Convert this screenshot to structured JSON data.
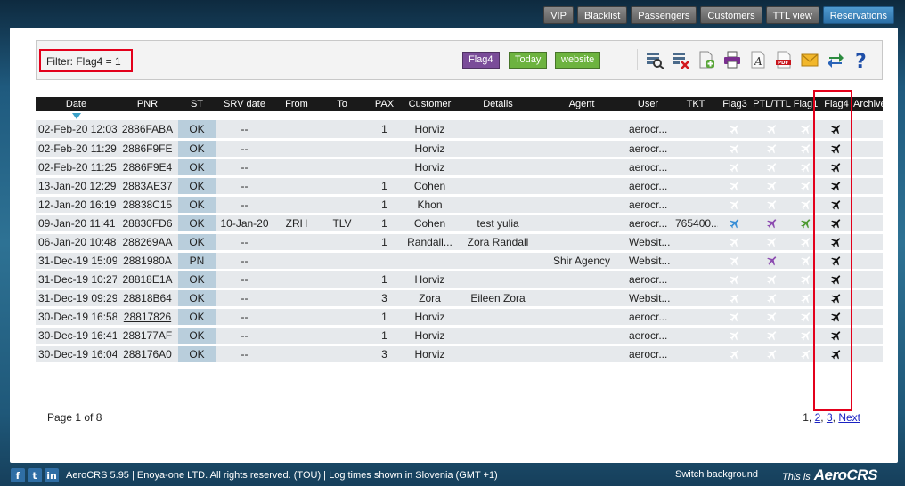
{
  "nav": {
    "buttons": [
      {
        "label": "VIP"
      },
      {
        "label": "Blacklist"
      },
      {
        "label": "Passengers"
      },
      {
        "label": "Customers"
      },
      {
        "label": "TTL view"
      },
      {
        "label": "Reservations"
      }
    ]
  },
  "filter": {
    "label": "Filter: Flag4 = 1",
    "tags": [
      {
        "label": "Flag4",
        "color": "#7a4c99"
      },
      {
        "label": "Today",
        "color": "#6db33f"
      },
      {
        "label": "website",
        "color": "#6db33f"
      }
    ],
    "tools": [
      "search-detail-icon",
      "clear-filter-icon",
      "export-icon",
      "print-icon",
      "text-icon",
      "pdf-icon",
      "email-icon",
      "refresh-icon",
      "help-icon"
    ]
  },
  "table": {
    "columns": [
      "Date",
      "PNR",
      "ST",
      "SRV date",
      "From",
      "To",
      "PAX",
      "Customer",
      "Details",
      "Agent",
      "User",
      "TKT",
      "Flag3",
      "PTL/TTL",
      "Flag1",
      "Flag4",
      "Archive"
    ],
    "rows": [
      {
        "date": "02-Feb-20 12:03",
        "pnr": "2886FABA",
        "st": "OK",
        "srv": "--",
        "from": "",
        "to": "",
        "pax": "1",
        "customer": "Horviz",
        "details": "",
        "agent": "",
        "user": "aerocr...",
        "tkt": "",
        "flag3": "off",
        "ptl": "off",
        "flag1": "off"
      },
      {
        "date": "02-Feb-20 11:29",
        "pnr": "2886F9FE",
        "st": "OK",
        "srv": "--",
        "from": "",
        "to": "",
        "pax": "",
        "customer": "Horviz",
        "details": "",
        "agent": "",
        "user": "aerocr...",
        "tkt": "",
        "flag3": "off",
        "ptl": "off",
        "flag1": "off"
      },
      {
        "date": "02-Feb-20 11:25",
        "pnr": "2886F9E4",
        "st": "OK",
        "srv": "--",
        "from": "",
        "to": "",
        "pax": "",
        "customer": "Horviz",
        "details": "",
        "agent": "",
        "user": "aerocr...",
        "tkt": "",
        "flag3": "off",
        "ptl": "off",
        "flag1": "off"
      },
      {
        "date": "13-Jan-20 12:29",
        "pnr": "2883AE37",
        "st": "OK",
        "srv": "--",
        "from": "",
        "to": "",
        "pax": "1",
        "customer": "Cohen",
        "details": "",
        "agent": "",
        "user": "aerocr...",
        "tkt": "",
        "flag3": "off",
        "ptl": "off",
        "flag1": "off"
      },
      {
        "date": "12-Jan-20 16:19",
        "pnr": "28838C15",
        "st": "OK",
        "srv": "--",
        "from": "",
        "to": "",
        "pax": "1",
        "customer": "Khon",
        "details": "",
        "agent": "",
        "user": "aerocr...",
        "tkt": "",
        "flag3": "off",
        "ptl": "off",
        "flag1": "off"
      },
      {
        "date": "09-Jan-20 11:41",
        "pnr": "28830FD6",
        "st": "OK",
        "srv": "10-Jan-20",
        "from": "ZRH",
        "to": "TLV",
        "pax": "1",
        "customer": "Cohen",
        "details": "test yulia",
        "agent": "",
        "user": "aerocr...",
        "tkt": "765400...",
        "flag3": "on",
        "ptl": "on",
        "flag1": "on"
      },
      {
        "date": "06-Jan-20 10:48",
        "pnr": "288269AA",
        "st": "OK",
        "srv": "--",
        "from": "",
        "to": "",
        "pax": "1",
        "customer": "Randall...",
        "details": "Zora Randall",
        "agent": "",
        "user": "Websit...",
        "tkt": "",
        "flag3": "off",
        "ptl": "off",
        "flag1": "off"
      },
      {
        "date": "31-Dec-19 15:09",
        "pnr": "2881980A",
        "st": "PN",
        "srv": "--",
        "from": "",
        "to": "",
        "pax": "",
        "customer": "",
        "details": "",
        "agent": "Shir Agency",
        "user": "Websit...",
        "tkt": "",
        "flag3": "off",
        "ptl": "on",
        "flag1": "off"
      },
      {
        "date": "31-Dec-19 10:27",
        "pnr": "28818E1A",
        "st": "OK",
        "srv": "--",
        "from": "",
        "to": "",
        "pax": "1",
        "customer": "Horviz",
        "details": "",
        "agent": "",
        "user": "aerocr...",
        "tkt": "",
        "flag3": "off",
        "ptl": "off",
        "flag1": "off"
      },
      {
        "date": "31-Dec-19 09:29",
        "pnr": "28818B64",
        "st": "OK",
        "srv": "--",
        "from": "",
        "to": "",
        "pax": "3",
        "customer": "Zora",
        "details": "Eileen Zora",
        "agent": "",
        "user": "Websit...",
        "tkt": "",
        "flag3": "off",
        "ptl": "off",
        "flag1": "off"
      },
      {
        "date": "30-Dec-19 16:58",
        "pnr": "28817826",
        "st": "OK",
        "srv": "--",
        "from": "",
        "to": "",
        "pax": "1",
        "customer": "Horviz",
        "details": "",
        "agent": "",
        "user": "aerocr...",
        "tkt": "",
        "flag3": "off",
        "ptl": "off",
        "flag1": "off",
        "pnr_link": true
      },
      {
        "date": "30-Dec-19 16:41",
        "pnr": "288177AF",
        "st": "OK",
        "srv": "--",
        "from": "",
        "to": "",
        "pax": "1",
        "customer": "Horviz",
        "details": "",
        "agent": "",
        "user": "aerocr...",
        "tkt": "",
        "flag3": "off",
        "ptl": "off",
        "flag1": "off"
      },
      {
        "date": "30-Dec-19 16:04",
        "pnr": "288176A0",
        "st": "OK",
        "srv": "--",
        "from": "",
        "to": "",
        "pax": "3",
        "customer": "Horviz",
        "details": "",
        "agent": "",
        "user": "aerocr...",
        "tkt": "",
        "flag3": "off",
        "ptl": "off",
        "flag1": "off"
      }
    ],
    "flag_colors": {
      "flag3": "#3a8fd6",
      "ptl": "#8c4bb0",
      "flag1": "#4f9a33",
      "flag4": "#111111",
      "off": "#ffffff"
    }
  },
  "pagination": {
    "info": "Page 1 of 8",
    "current": "1,",
    "links": [
      {
        "label": "2"
      },
      {
        "label": "3"
      },
      {
        "label": "Next"
      }
    ],
    "sep": ","
  },
  "footer": {
    "social": [
      "f",
      "t",
      "in"
    ],
    "text": "AeroCRS 5.95  | Enoya-one LTD. All rights reserved. (TOU) | Log times shown in Slovenia (GMT +1)",
    "switch_bg": "Switch background",
    "this_is": "This is",
    "brand": "AeroCRS"
  }
}
